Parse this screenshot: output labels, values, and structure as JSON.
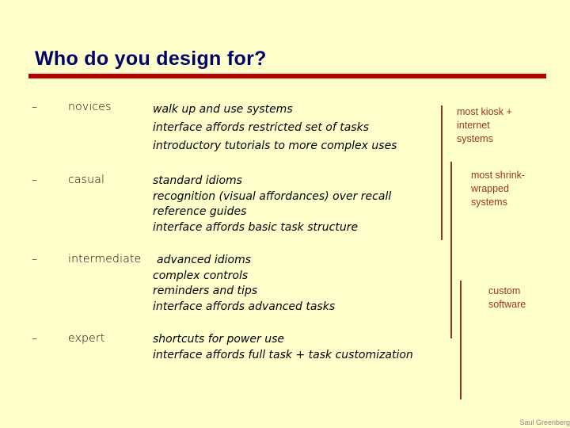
{
  "slide": {
    "title": "Who do you design for?",
    "colors": {
      "background": "#ffffcc",
      "title": "#000066",
      "rule": "#bb0000",
      "annotation": "#993322"
    },
    "bullet_glyph": "–",
    "users": [
      {
        "level": "novices",
        "descriptions": [
          "walk up and use systems",
          "interface affords restricted set of tasks",
          "introductory tutorials to more complex uses"
        ]
      },
      {
        "level": "casual",
        "descriptions": [
          "standard idioms",
          "recognition (visual affordances) over recall",
          "reference guides",
          "interface affords basic task structure"
        ]
      },
      {
        "level": "intermediate",
        "descriptions": [
          "advanced idioms",
          "complex controls",
          "reminders and tips",
          "interface affords advanced tasks"
        ]
      },
      {
        "level": "expert",
        "descriptions": [
          "shortcuts for power use",
          "interface affords full task + task customization"
        ]
      }
    ],
    "annotations": [
      {
        "lines": [
          "most kiosk +",
          "internet",
          "systems"
        ]
      },
      {
        "lines": [
          "most shrink-",
          "wrapped",
          "systems"
        ]
      },
      {
        "lines": [
          "custom",
          "software"
        ]
      }
    ],
    "credit": "Saul Greenberg"
  }
}
